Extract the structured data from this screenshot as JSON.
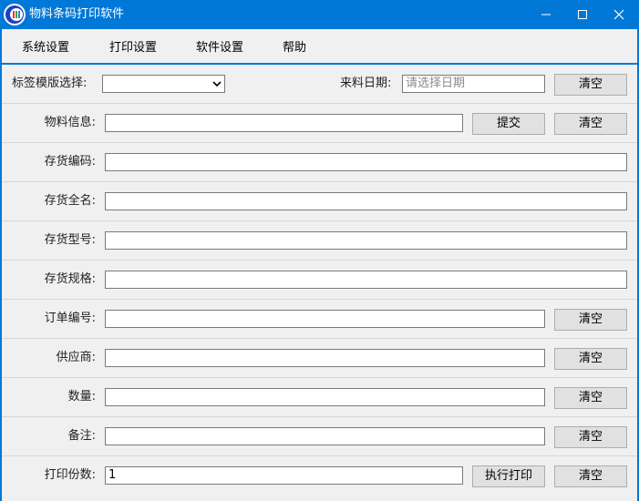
{
  "window": {
    "title": "物料条码打印软件",
    "accent_color": "#0078d7",
    "controls": [
      "minimize-icon",
      "maximize-icon",
      "close-icon"
    ]
  },
  "menu": {
    "items": [
      {
        "label": "系统设置"
      },
      {
        "label": "打印设置"
      },
      {
        "label": "软件设置"
      },
      {
        "label": "帮助"
      }
    ]
  },
  "form": {
    "template": {
      "label": "标签模版选择:",
      "value": ""
    },
    "arrival_date": {
      "label": "来料日期:",
      "placeholder": "请选择日期",
      "clear": "清空"
    },
    "material_info": {
      "label": "物料信息:",
      "value": "",
      "submit": "提交",
      "clear": "清空"
    },
    "inventory_code": {
      "label": "存货编码:",
      "value": ""
    },
    "inventory_name": {
      "label": "存货全名:",
      "value": ""
    },
    "inventory_model": {
      "label": "存货型号:",
      "value": ""
    },
    "inventory_spec": {
      "label": "存货规格:",
      "value": ""
    },
    "order_number": {
      "label": "订单编号:",
      "value": "",
      "clear": "清空"
    },
    "supplier": {
      "label": "供应商:",
      "value": "",
      "clear": "清空"
    },
    "quantity": {
      "label": "数量:",
      "value": "",
      "clear": "清空"
    },
    "remark": {
      "label": "备注:",
      "value": "",
      "clear": "清空"
    },
    "copies": {
      "label": "打印份数:",
      "value": "1",
      "print": "执行打印",
      "clear": "清空"
    }
  }
}
